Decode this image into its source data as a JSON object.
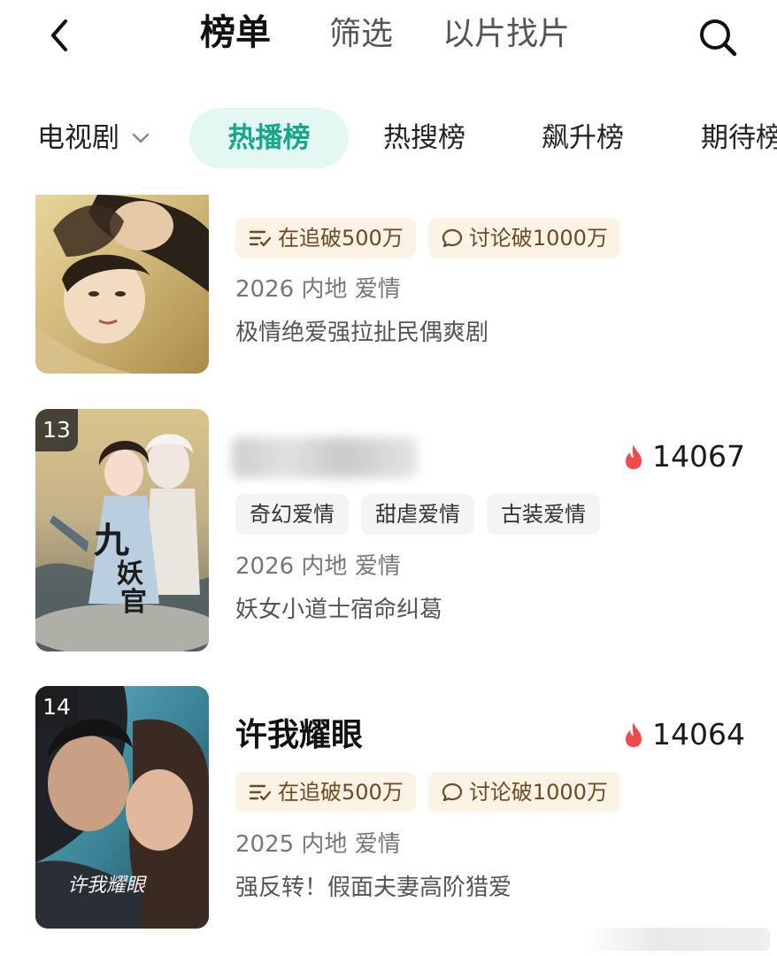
{
  "header": {
    "tabs": [
      {
        "label": "榜单",
        "active": true
      },
      {
        "label": "筛选",
        "active": false
      },
      {
        "label": "以片找片",
        "active": false
      }
    ],
    "back_icon": "chevron-left-icon",
    "search_icon": "search-icon"
  },
  "category": {
    "selected": "电视剧",
    "rank_tabs": [
      {
        "label": "热播榜",
        "active": true
      },
      {
        "label": "热搜榜",
        "active": false
      },
      {
        "label": "飙升榜",
        "active": false
      },
      {
        "label": "期待榜",
        "active": false
      }
    ]
  },
  "items": [
    {
      "rank": "",
      "title": "",
      "heat": "",
      "tags": [
        {
          "icon": "list-check-icon",
          "text": "在追破500万"
        },
        {
          "icon": "chat-bubble-icon",
          "text": "讨论破1000万"
        }
      ],
      "meta": "2026 内地 爱情",
      "desc": "极情绝爱强拉扯民偶爽剧"
    },
    {
      "rank": "13",
      "title": "",
      "heat": "14067",
      "tags": [
        {
          "text": "奇幻爱情"
        },
        {
          "text": "甜虐爱情"
        },
        {
          "text": "古装爱情"
        }
      ],
      "meta": "2026 内地 爱情",
      "desc": "妖女小道士宿命纠葛"
    },
    {
      "rank": "14",
      "title": "许我耀眼",
      "heat": "14064",
      "tags": [
        {
          "icon": "list-check-icon",
          "text": "在追破500万"
        },
        {
          "icon": "chat-bubble-icon",
          "text": "讨论破1000万"
        }
      ],
      "meta": "2025 内地 爱情",
      "desc": "强反转！假面夫妻高阶猎爱",
      "poster_text": "许我耀眼"
    }
  ],
  "colors": {
    "accent": "#17a78a",
    "accent_bg": "#e3f8f3",
    "tag_gold_bg": "#fbf3e6",
    "tag_gold_text": "#6b4b21",
    "heat_flame": "#f04a4a"
  }
}
